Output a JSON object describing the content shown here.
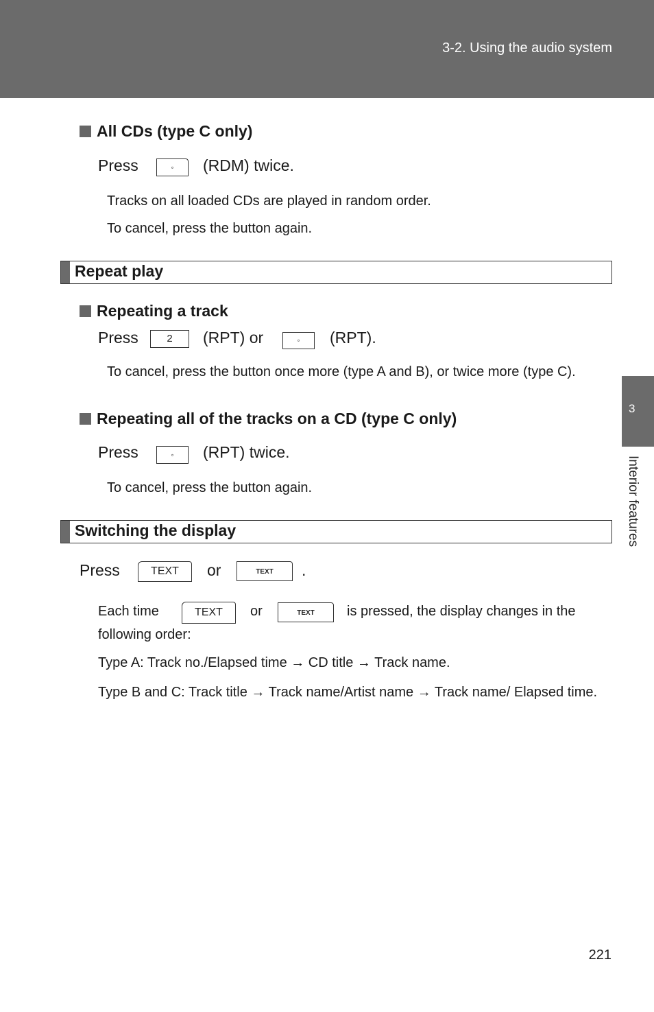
{
  "header": {
    "title": "3-2. Using the audio system"
  },
  "side_tab": {
    "number": "3",
    "label": "Interior features"
  },
  "all_cds": {
    "heading": "All CDs (type C only)",
    "press": "Press",
    "button_glyph": "◦",
    "after": "(RDM) twice.",
    "note1": "Tracks on all loaded CDs are played in random order.",
    "note2": "To cancel, press the button again."
  },
  "repeat_play": {
    "section_title": "Repeat play",
    "track": {
      "heading": "Repeating a track",
      "press": "Press",
      "button1_label": "2",
      "mid": "(RPT) or",
      "button2_glyph": "◦",
      "after": "(RPT).",
      "note": "To cancel, press the button once more (type A and B), or twice more (type C)."
    },
    "all_tracks": {
      "heading": "Repeating all of the tracks on a CD (type C only)",
      "press": "Press",
      "button_glyph": "◦",
      "after": "(RPT) twice.",
      "note": "To cancel, press the button again."
    }
  },
  "switching": {
    "section_title": "Switching the display",
    "press": "Press",
    "button1_label": "TEXT",
    "or": "or",
    "button2_label": "TEXT",
    "period": ".",
    "each_time": "Each time",
    "each_or": "or",
    "each_after": "is pressed, the display changes in the",
    "following": "following order:",
    "type_a": "Type A: Track no./Elapsed time → CD title → Track name.",
    "type_bc": "Type B and C: Track title → Track name/Artist name → Track name/ Elapsed time."
  },
  "page_number": "221"
}
